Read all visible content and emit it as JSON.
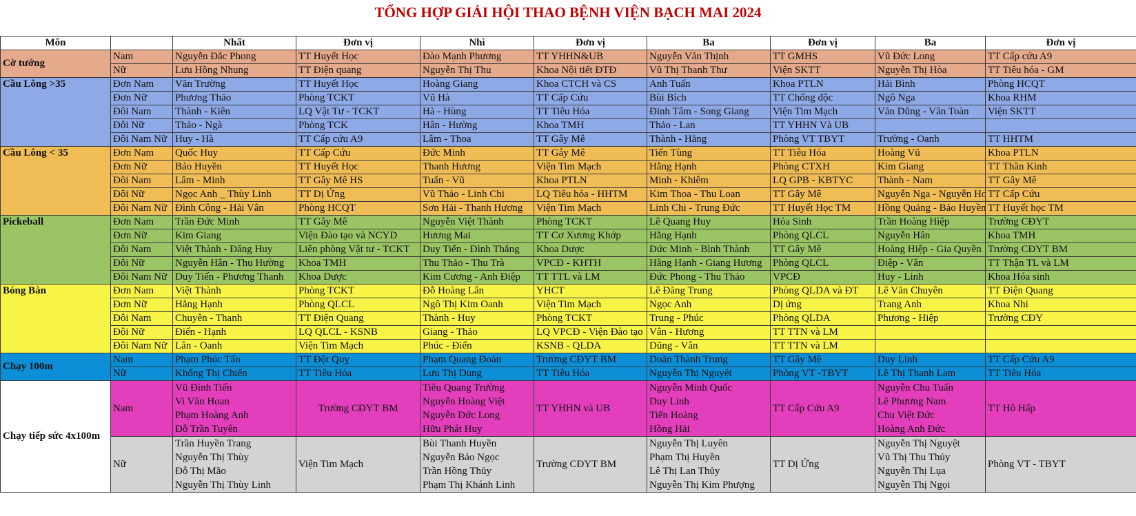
{
  "title": "TỔNG HỢP GIẢI HỘI THAO BỆNH VIỆN BẠCH MAI 2024",
  "headers": [
    "Môn",
    "",
    "Nhất",
    "Đơn vị",
    "Nhì",
    "Đơn vị",
    "Ba",
    "Đơn vị",
    "Ba",
    "Đơn vị"
  ],
  "colors": {
    "co_tuong": "#e5a98b",
    "cau_long": "#8fa9e6",
    "cau_long_u35": "#f0bc55",
    "pickleball": "#9bc465",
    "bong_ban": "#f7f447",
    "chay_100m": "#0d8fd8",
    "tiep_suc_nam": "#e33fbc",
    "tiep_suc_nu": "#d3d3d3",
    "title": "#c00000"
  },
  "groups": [
    {
      "sport": "Cờ tướng",
      "rows": [
        [
          "Nam",
          "Nguyễn Đắc Phong",
          "TT Huyết Học",
          "Đào Mạnh Phương",
          "TT YHHN&UB",
          "Nguyễn Văn Thịnh",
          "TT GMHS",
          "Vũ Đức Long",
          "TT Cấp cứu A9"
        ],
        [
          "Nữ",
          "Lưu Hồng Nhung",
          "TT Điện quang",
          "Nguyễn Thị Thu",
          "Khoa Nội tiết ĐTĐ",
          "Vũ Thị Thanh Thư",
          "Viện SKTT",
          "Nguyễn Thị Hòa",
          "TT Tiêu hóa - GM"
        ]
      ]
    },
    {
      "sport": "Cầu Lông >35",
      "rows": [
        [
          "Đơn Nam",
          "Văn Trường",
          "TT Huyết Học",
          "Hoàng Giang",
          "Khoa CTCH và CS",
          "Anh Tuấn",
          "Khoa PTLN",
          "Hải Bình",
          "Phòng HCQT"
        ],
        [
          "Đơn Nữ",
          "Phương Thảo",
          "Phòng TCKT",
          "Vũ Hà",
          "TT Cấp Cứu",
          "Bùi Bích",
          "TT Chống độc",
          "Ngô Nga",
          "Khoa RHM"
        ],
        [
          "Đôi Nam",
          "Thành - Kiên",
          "LQ Vật Tư - TCKT",
          "Hà - Hùng",
          "TT Tiêu Hóa",
          "Đinh Tâm - Song Giang",
          "Viện Tim Mạch",
          "Văn Dũng - Văn Toàn",
          "Viện SKTT"
        ],
        [
          "Đôi Nữ",
          "Thảo - Ngà",
          "Phòng TCK",
          "Hân - Hường",
          "Khoa TMH",
          "Thảo - Lan",
          "TT YHHN Và UB",
          "",
          ""
        ],
        [
          "Đôi Nam Nữ",
          "Huy - Hà",
          "TT Cấp cứu A9",
          "Lâm - Thoa",
          "TT Gây Mê",
          "Thành - Hằng",
          "Phòng VT TBYT",
          "Trường - Oanh",
          "TT HHTM"
        ]
      ]
    },
    {
      "sport": "Cầu Lông < 35",
      "rows": [
        [
          "Đơn Nam",
          "Quốc Huy",
          "TT Cấp Cứu",
          "Đức Minh",
          "TT Gây Mê",
          "Tiến Tùng",
          "TT Tiêu Hóa",
          "Hoàng Vũ",
          "Khoa PTLN"
        ],
        [
          "Đơn Nữ",
          "Bảo Huyền",
          "TT Huyết Học",
          "Thanh Hương",
          "Viện Tim Mạch",
          "Hằng Hạnh",
          "Phòng CTXH",
          "Kim Giang",
          "TT Thần Kinh"
        ],
        [
          "Đôi Nam",
          "Lâm - Minh",
          "TT Gây Mê HS",
          "Tuấn - Vũ",
          "Khoa PTLN",
          "Minh - Khiêm",
          "LQ GPB - KBTYC",
          "Thành - Nam",
          "TT Gây Mê"
        ],
        [
          "Đôi Nữ",
          "Ngọc Anh _ Thùy Linh",
          "TT Dị Ứng",
          "Vũ Thảo - Linh Chi",
          "LQ Tiêu hóa - HHTM",
          "Kim Thoa - Thu Loan",
          "TT Gây Mê",
          "Nguyễn Nga - Nguyễn Hoa",
          "TT Cấp Cứu"
        ],
        [
          "Đôi Nam Nữ",
          "Đình Công - Hải Vân",
          "Phòng HCQT",
          "Sơn Hải - Thanh Hương",
          "Viện Tim Mạch",
          "Linh Chi - Trung Đức",
          "TT Huyết Học TM",
          "Hồng Quảng - Bảo Huyền",
          "TT Huyết học TM"
        ]
      ]
    },
    {
      "sport": "Pickeball",
      "rows": [
        [
          "Đơn Nam",
          "Trần Đức Minh",
          "TT Gây Mê",
          "Nguyễn Việt Thành",
          "Phòng TCKT",
          "Lê Quang Huy",
          "Hóa Sinh",
          "Trần Hoàng Hiệp",
          "Trường CĐYT"
        ],
        [
          "Đơn Nữ",
          "Kim Giang",
          "Viện Đào tạo và NCYD",
          "Hương Mai",
          "TT Cơ Xương Khớp",
          "Hằng Hạnh",
          "Phòng QLCL",
          "Nguyễn Hân",
          "Khoa TMH"
        ],
        [
          "Đôi Nam",
          "Việt Thành - Đăng Huy",
          "Liên phòng Vật tư - TCKT",
          "Duy Tiến - Đình Thắng",
          "Khoa Dược",
          "Đức Minh - Bình Thành",
          "TT Gây Mê",
          "Hoàng Hiệp - Gia Quyền",
          "Trường CĐYT BM"
        ],
        [
          "Đôi Nữ",
          "Nguyễn Hân - Thu Hường",
          "Khoa TMH",
          "Thu Thảo - Thu Trà",
          "VPCĐ - KHTH",
          "Hằng Hạnh - Giang Hương",
          "Phòng QLCL",
          "Điệp - Vân",
          "TT Thận TL và LM"
        ],
        [
          "Đôi Nam Nữ",
          "Duy Tiến - Phương Thanh",
          "Khoa Dược",
          "Kim Cương - Anh Điệp",
          "TT TTL và LM",
          "Đức Phong - Thu Thảo",
          "VPCĐ",
          "Huy - Linh",
          "Khoa Hóa sinh"
        ]
      ]
    },
    {
      "sport": "Bóng Bàn",
      "rows": [
        [
          "Đơn Nam",
          "Việt Thành",
          "Phòng TCKT",
          "Đỗ Hoàng Lân",
          "YHCT",
          "Lê Đăng Trung",
          "Phòng QLDA và ĐT",
          "Lê Văn Chuyên",
          "TT Điện Quang"
        ],
        [
          "Đơn Nữ",
          "Hằng Hạnh",
          "Phòng QLCL",
          "Ngô Thị Kim Oanh",
          "Viện Tim Mạch",
          "Ngọc Anh",
          "Dị ứng",
          "Trang Anh",
          "Khoa Nhi"
        ],
        [
          "Đôi Nam",
          "Chuyên - Thanh",
          "TT Điện Quang",
          "Thành - Huy",
          "Phòng TCKT",
          "Trung - Phúc",
          "Phòng QLDA",
          "Phương - Hiệp",
          "Trường CĐY"
        ],
        [
          "Đôi Nữ",
          "Điển - Hạnh",
          "LQ QLCL - KSNB",
          "Giang - Thảo",
          "LQ VPCĐ - Viện Đào tạo",
          "Vân - Hương",
          "TT TTN và LM",
          "",
          ""
        ],
        [
          "Đôi Nam Nữ",
          "Lân - Oanh",
          "Viện Tim Mạch",
          "Phúc - Điển",
          "KSNB - QLDA",
          "Dũng - Vân",
          "TT TTN và LM",
          "",
          ""
        ]
      ]
    },
    {
      "sport": "Chạy 100m",
      "rows": [
        [
          "Nam",
          "Phạm Phúc Tấn",
          "TT Đột Quỵ",
          "Phạm Quang Đoàn",
          "Trường CĐYT BM",
          "Doãn Thành Trung",
          "TT Gây Mê",
          "Duy Linh",
          "TT Cấp Cứu A9"
        ],
        [
          "Nữ",
          "Khổng Thị Chiến",
          "TT Tiêu Hóa",
          "Lưu Thị Dung",
          "TT Tiêu Hóa",
          "Nguyễn Thị Nguyệt",
          "Phòng VT -TBYT",
          "Lê Thị Thanh Lam",
          "TT Tiêu Hóa"
        ]
      ]
    }
  ],
  "relay": {
    "sport": "Chạy tiếp sức 4x100m",
    "nam": {
      "label": "Nam",
      "nhat": [
        "Vũ Đình Tiến",
        "Vi Văn Hoan",
        "Phạm Hoàng Anh",
        "Đỗ Trần Tuyên"
      ],
      "nhat_dv": "Trường CĐYT BM",
      "nhi": [
        "Tiêu Quang Trường",
        "Nguyễn Hoàng Việt",
        "Nguyễn Đức Long",
        "Hữu Phát Huy"
      ],
      "nhi_dv": "TT YHHN và UB",
      "ba1": [
        "Nguyễn Minh Quốc",
        "Duy Linh",
        "Tiến Hoàng",
        "Hồng Hải"
      ],
      "ba1_dv": "TT Cấp Cứu A9",
      "ba2": [
        "Nguyễn Chu Tuấn",
        "Lê Phương Nam",
        "Chu Việt Đức",
        "Hoàng Anh Đức"
      ],
      "ba2_dv": "TT Hô Hấp"
    },
    "nu": {
      "label": "Nữ",
      "nhat": [
        "Trần Huyền Trang",
        "Nguyễn Thị Thùy",
        "Đỗ Thị Mão",
        "Nguyễn Thị Thùy Linh"
      ],
      "nhat_dv": "Viện Tim Mạch",
      "nhi": [
        "Bùi Thanh Huyền",
        "Nguyễn Bảo Ngọc",
        "Trần Hồng Thủy",
        "Phạm Thị Khánh Linh"
      ],
      "nhi_dv": "Trường CĐYT BM",
      "ba1": [
        "Nguyễn Thị Luyên",
        "Phạm Thị Huyền",
        "Lê Thị Lan Thủy",
        "Nguyễn Thị Kim Phượng"
      ],
      "ba1_dv": "TT Dị Ứng",
      "ba2": [
        "Nguyễn Thị Nguyệt",
        "Vũ Thị Thu Thủy",
        "Nguyễn Thị Lụa",
        "Nguyễn Thị Ngọi"
      ],
      "ba2_dv": "Phòng VT - TBYT"
    }
  }
}
